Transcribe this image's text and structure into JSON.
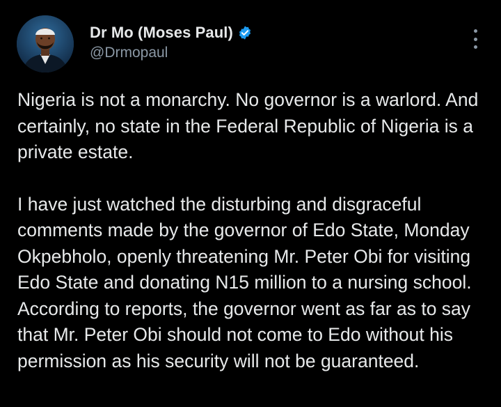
{
  "tweet": {
    "author": {
      "display_name": "Dr Mo (Moses Paul)",
      "handle": "@Drmopaul",
      "verified": true,
      "verified_color": "#1d9bf0"
    },
    "more_icon": "more-vertical-icon",
    "paragraphs": [
      "Nigeria is not a monarchy. No governor is a warlord. And certainly, no state in the Federal Republic of Nigeria is a private estate.",
      "I have just watched the disturbing and disgraceful comments made by the governor of Edo State, Monday Okpebholo, openly threatening Mr. Peter Obi for visiting Edo State and donating N15 million to a nursing school. According to reports, the governor went as far as to say that Mr. Peter Obi should not come to Edo without his permission as his security will not be guaranteed."
    ]
  },
  "colors": {
    "background": "#000000",
    "text_primary": "#e7e9ea",
    "text_secondary": "#8b98a5"
  }
}
